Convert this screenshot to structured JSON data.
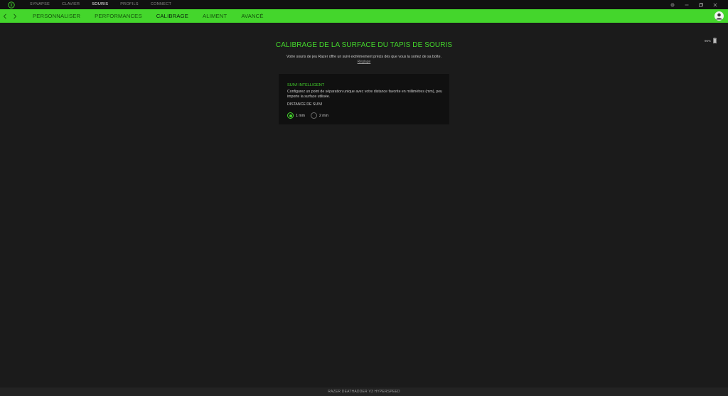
{
  "top_nav": {
    "tabs": [
      {
        "label": "SYNAPSE"
      },
      {
        "label": "CLAVIER"
      },
      {
        "label": "SOURIS"
      },
      {
        "label": "PROFILS"
      },
      {
        "label": "CONNECT"
      }
    ],
    "active": "SOURIS"
  },
  "sub_nav": {
    "tabs": [
      {
        "label": "PERSONNALISER"
      },
      {
        "label": "PERFORMANCES"
      },
      {
        "label": "CALIBRAGE"
      },
      {
        "label": "ALIMENT"
      },
      {
        "label": "AVANCÉ"
      }
    ],
    "active": "CALIBRAGE"
  },
  "battery": {
    "text": "95%",
    "level_percent": 95
  },
  "main": {
    "title": "CALIBRAGE DE LA SURFACE DU TAPIS DE SOURIS",
    "description": "Votre souris de jeu Razer offre un suivi extrêmement précis dès que vous la sortez de sa boîte.",
    "link": "Réglage"
  },
  "card": {
    "title": "SUIVI INTELLIGENT",
    "description": "Configurez un point de séparation unique avec votre distance favorite en millimètres (mm), peu importe la surface utilisée.",
    "distance_label": "DISTANCE DE SUIVI",
    "options": [
      {
        "label": "1 mm",
        "selected": true
      },
      {
        "label": "2 mm",
        "selected": false
      }
    ]
  },
  "footer": {
    "device_name": "RAZER DEATHADDER V3 HYPERSPEED"
  },
  "colors": {
    "accent": "#44d62c",
    "background": "#1b1b1b",
    "titlebar": "#111111",
    "card": "#101010"
  },
  "icons": [
    "razer-logo-icon",
    "settings-icon",
    "minimize-icon",
    "restore-icon",
    "close-icon",
    "back-arrow-icon",
    "forward-arrow-icon",
    "user-avatar-icon",
    "battery-icon"
  ]
}
